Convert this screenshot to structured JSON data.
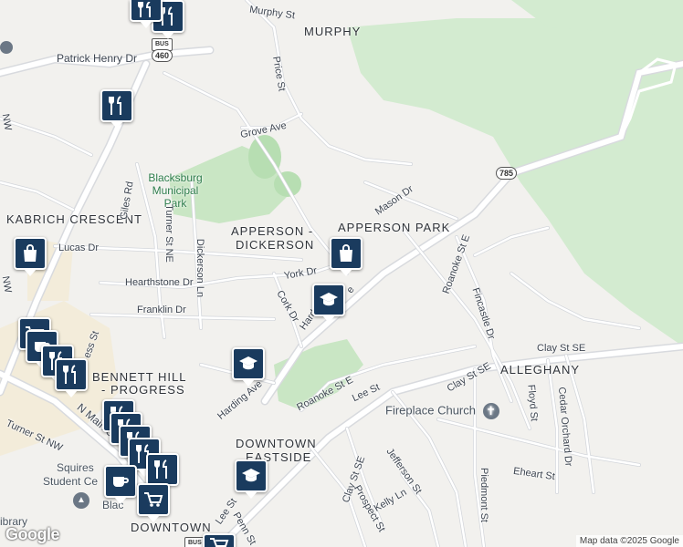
{
  "map": {
    "neighborhoods": [
      {
        "id": "murphy",
        "text": "MURPHY"
      },
      {
        "id": "kabrich",
        "text": "KABRICH CRESCENT"
      },
      {
        "id": "apperson-dickerson-1",
        "text": "APPERSON -"
      },
      {
        "id": "apperson-dickerson-2",
        "text": "DICKERSON"
      },
      {
        "id": "apperson-park",
        "text": "APPERSON PARK"
      },
      {
        "id": "bennett-1",
        "text": "BENNETT HILL"
      },
      {
        "id": "bennett-2",
        "text": "- PROGRESS"
      },
      {
        "id": "alleghany",
        "text": "ALLEGHANY"
      },
      {
        "id": "downtown-eastside-1",
        "text": "DOWNTOWN"
      },
      {
        "id": "downtown-eastside-2",
        "text": "EASTSIDE"
      },
      {
        "id": "downtown",
        "text": "DOWNTOWN"
      }
    ],
    "park": {
      "line1": "Blacksburg",
      "line2": "Municipal",
      "line3": "Park"
    },
    "streets": [
      {
        "id": "murphy-st",
        "text": "Murphy St"
      },
      {
        "id": "price-st",
        "text": "Price St"
      },
      {
        "id": "patrick-henry-dr",
        "text": "Patrick Henry Dr"
      },
      {
        "id": "grove-ave",
        "text": "Grove Ave"
      },
      {
        "id": "mason-dr",
        "text": "Mason Dr"
      },
      {
        "id": "giles-rd",
        "text": "Giles Rd"
      },
      {
        "id": "turner-st-ne",
        "text": "Turner St NE"
      },
      {
        "id": "dickerson-ln",
        "text": "Dickerson Ln"
      },
      {
        "id": "lucas-dr",
        "text": "Lucas Dr"
      },
      {
        "id": "hearthstone-dr",
        "text": "Hearthstone Dr"
      },
      {
        "id": "york-dr",
        "text": "York Dr"
      },
      {
        "id": "cork-dr",
        "text": "Cork Dr"
      },
      {
        "id": "harding-ave-1",
        "text": "Hard"
      },
      {
        "id": "harding-ave-2",
        "text": "e"
      },
      {
        "id": "franklin-dr",
        "text": "Franklin Dr"
      },
      {
        "id": "roanoke-st-e",
        "text": "Roanoke St E"
      },
      {
        "id": "roanoke-st-e-2",
        "text": "Roanoke St E"
      },
      {
        "id": "fincastle-dr",
        "text": "Fincastle Dr"
      },
      {
        "id": "clay-st-se",
        "text": "Clay St SE"
      },
      {
        "id": "clay-st-se-2",
        "text": "Clay St SE"
      },
      {
        "id": "clay-st-se-3",
        "text": "Clay St SE"
      },
      {
        "id": "lee-st",
        "text": "Lee St"
      },
      {
        "id": "lee-st-2",
        "text": "Lee St"
      },
      {
        "id": "harding-ave",
        "text": "Harding Ave"
      },
      {
        "id": "floyd-st",
        "text": "Floyd St"
      },
      {
        "id": "cedar-orchard-dr",
        "text": "Cedar Orchard Dr"
      },
      {
        "id": "eheart-st",
        "text": "Eheart St"
      },
      {
        "id": "jefferson-st",
        "text": "Jefferson St"
      },
      {
        "id": "piedmont-st",
        "text": "Piedmont St"
      },
      {
        "id": "prospect-st",
        "text": "Prospect St"
      },
      {
        "id": "kelly-ln",
        "text": "Kelly Ln"
      },
      {
        "id": "penn-st",
        "text": "Penn St"
      },
      {
        "id": "n-main-st",
        "text": "N Main St"
      },
      {
        "id": "turner-st-nw",
        "text": "Turner St NW"
      },
      {
        "id": "progress-st",
        "text": "ess St"
      },
      {
        "id": "nw-1",
        "text": "NW"
      },
      {
        "id": "nw-2",
        "text": "NW"
      }
    ],
    "pois": [
      {
        "id": "fireplace-church",
        "text": "Fireplace Church"
      },
      {
        "id": "squires",
        "text": "Squires"
      },
      {
        "id": "student-center",
        "text": "Student Ce"
      },
      {
        "id": "library",
        "text": "ibrary"
      },
      {
        "id": "blacksburg",
        "text": "Blac"
      }
    ],
    "shields": {
      "bus460": "460",
      "bus460_label": "BUS",
      "r785": "785",
      "bus_bottom": "BUS"
    },
    "markers": [
      {
        "id": "restaurant-top-1",
        "icon": "restaurant-icon"
      },
      {
        "id": "restaurant-top-2",
        "icon": "restaurant-icon"
      },
      {
        "id": "restaurant-left",
        "icon": "restaurant-icon"
      },
      {
        "id": "shopping-left",
        "icon": "shopping-bag-icon"
      },
      {
        "id": "shopping-apperson",
        "icon": "shopping-bag-icon"
      },
      {
        "id": "school-harding",
        "icon": "school-icon"
      },
      {
        "id": "school-bennett",
        "icon": "school-icon"
      },
      {
        "id": "school-eastside",
        "icon": "school-icon"
      },
      {
        "id": "grocery-1",
        "icon": "grocery-cart-icon"
      },
      {
        "id": "cafe-1",
        "icon": "cafe-icon"
      },
      {
        "id": "restaurant-2",
        "icon": "restaurant-icon"
      },
      {
        "id": "restaurant-3",
        "icon": "restaurant-icon"
      },
      {
        "id": "cafe-downtown",
        "icon": "cafe-icon"
      },
      {
        "id": "grocery-downtown",
        "icon": "grocery-cart-icon"
      }
    ],
    "colors": {
      "land": "#f2f1ee",
      "park": "#c9e6c4",
      "forest": "#d3ebd0",
      "road": "#ffffff",
      "road_edge": "#d8dade",
      "marker": "#1a3b5e",
      "campus": "#f0e6cc"
    },
    "attribution": "Map data ©2025 Google",
    "logo": "Google"
  }
}
